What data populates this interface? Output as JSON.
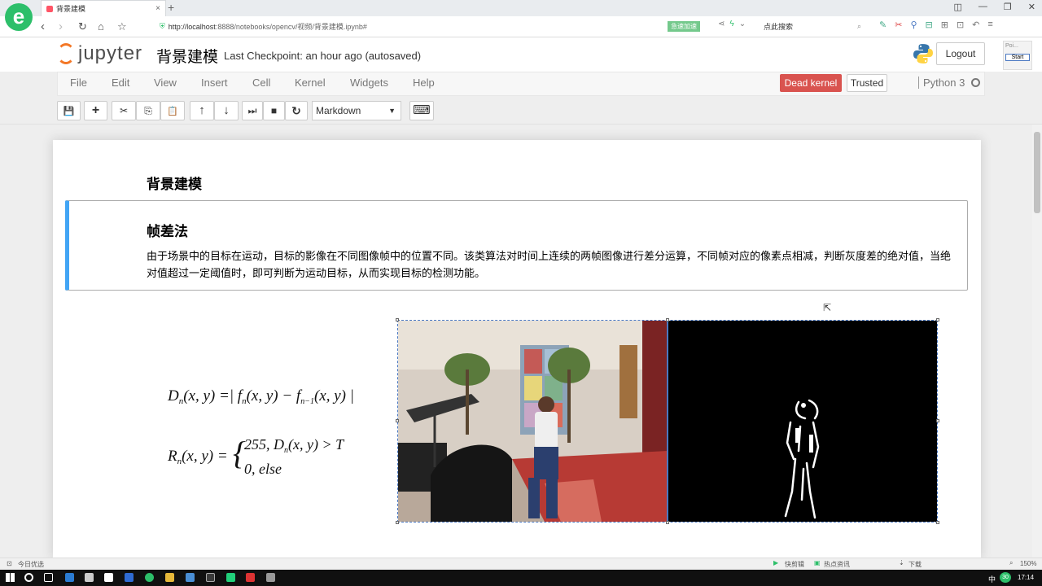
{
  "browser": {
    "logo_letter": "e",
    "tab_title": "背景建模",
    "tab_close": "×",
    "new_tab": "+",
    "window_controls": [
      "◫",
      "—",
      "❐",
      "✕"
    ],
    "nav_buttons": [
      "‹",
      "›",
      "↻",
      "⌂",
      "☆"
    ],
    "url_host": "http://localhost",
    "url_path": ":8888/notebooks/opencv/视频/背景建模.ipynb#",
    "speed_badge": "急速加速",
    "search_placeholder": "点此搜索",
    "search_icon": "⌕",
    "extension_icons": [
      "✎",
      "✂",
      "⚲",
      "⊟",
      "⊞",
      "⊡",
      "↶",
      "≡"
    ]
  },
  "jupyter": {
    "logo_text": "jupyter",
    "notebook_title": "背景建模",
    "checkpoint": "Last Checkpoint: an hour ago (autosaved)",
    "logout": "Logout",
    "side_widget_label": "Poi...",
    "side_widget_button": "Start"
  },
  "menu": {
    "items": [
      "File",
      "Edit",
      "View",
      "Insert",
      "Cell",
      "Kernel",
      "Widgets",
      "Help"
    ],
    "dead_kernel": "Dead kernel",
    "trusted": "Trusted",
    "kernel_name": "Python 3"
  },
  "toolbar": {
    "buttons": [
      "💾",
      "+",
      "✂",
      "⎘",
      "📋",
      "↑",
      "↓",
      "⏭",
      "■",
      "↻"
    ],
    "cell_type": "Markdown",
    "keyboard_icon": "⌨"
  },
  "notebook": {
    "heading1": "背景建模",
    "heading2": "帧差法",
    "paragraph": "由于场景中的目标在运动，目标的影像在不同图像帧中的位置不同。该类算法对时间上连续的两帧图像进行差分运算，不同帧对应的像素点相减，判断灰度差的绝对值，当绝对值超过一定阈值时，即可判断为运动目标，从而实现目标的检测功能。"
  },
  "status_bar": {
    "left": "今日优选",
    "items": [
      "快剪辑",
      "热点资讯",
      "下载",
      "150%"
    ]
  },
  "taskbar": {
    "ime": "中",
    "time": "17:14",
    "badge": "30"
  },
  "colors": {
    "dead_kernel_bg": "#d9534f",
    "cell_accent": "#42a5f5",
    "jupyter_orange": "#f37726",
    "browser_green": "#2dbf6a"
  }
}
